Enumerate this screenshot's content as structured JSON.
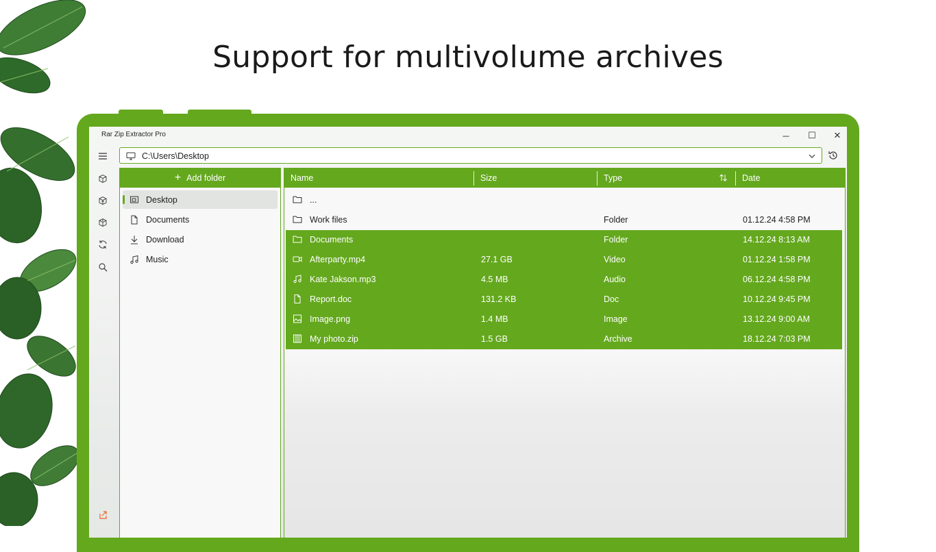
{
  "headline": "Support for multivolume archives",
  "window": {
    "title": "Rar Zip Extractor Pro",
    "minimize_label": "─",
    "maximize_label": "☐",
    "close_label": "✕"
  },
  "address": {
    "path": "C:\\Users\\Desktop"
  },
  "sidebar": {
    "add_folder_label": "Add folder",
    "items": [
      {
        "label": "Desktop",
        "icon": "desktop-icon",
        "active": true
      },
      {
        "label": "Documents",
        "icon": "document-icon"
      },
      {
        "label": "Download",
        "icon": "download-icon"
      },
      {
        "label": "Music",
        "icon": "music-icon"
      }
    ]
  },
  "columns": {
    "name": "Name",
    "size": "Size",
    "type": "Type",
    "date": "Date"
  },
  "files": [
    {
      "name": "...",
      "size": "",
      "type": "",
      "date": "",
      "icon": "folder-icon",
      "selected": false
    },
    {
      "name": "Work files",
      "size": "",
      "type": "Folder",
      "date": "01.12.24 4:58 PM",
      "icon": "folder-icon",
      "selected": false
    },
    {
      "name": "Documents",
      "size": "",
      "type": "Folder",
      "date": "14.12.24 8:13 AM",
      "icon": "folder-icon",
      "selected": true
    },
    {
      "name": "Afterparty.mp4",
      "size": "27.1 GB",
      "type": "Video",
      "date": "01.12.24 1:58 PM",
      "icon": "video-icon",
      "selected": true
    },
    {
      "name": "Kate Jakson.mp3",
      "size": "4.5 MB",
      "type": "Audio",
      "date": "06.12.24 4:58 PM",
      "icon": "audio-icon",
      "selected": true
    },
    {
      "name": "Report.doc",
      "size": "131.2 KB",
      "type": "Doc",
      "date": "10.12.24 9:45 PM",
      "icon": "document-icon",
      "selected": true
    },
    {
      "name": "Image.png",
      "size": "1.4 MB",
      "type": "Image",
      "date": "13.12.24 9:00 AM",
      "icon": "image-icon",
      "selected": true
    },
    {
      "name": "My photo.zip",
      "size": "1.5 GB",
      "type": "Archive",
      "date": "18.12.24 7:03 PM",
      "icon": "archive-icon",
      "selected": true
    }
  ],
  "colors": {
    "accent": "#64a81e",
    "share_icon": "#e8652b"
  }
}
